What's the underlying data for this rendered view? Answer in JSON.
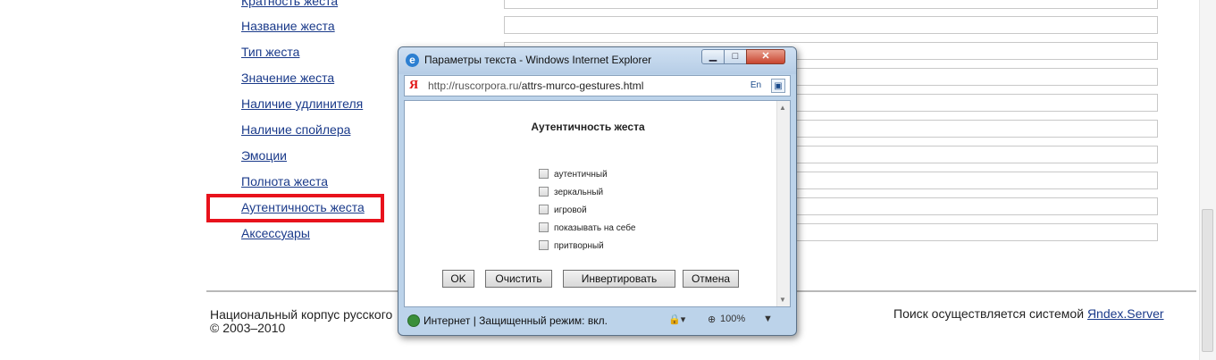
{
  "form": {
    "links": [
      "Кратность жеста",
      "Название жеста",
      "Тип жеста",
      "Значение жеста",
      "Наличие удлинителя",
      "Наличие спойлера",
      "Эмоции",
      "Полнота жеста",
      "Аутентичность жеста",
      "Аксессуары"
    ]
  },
  "footer": {
    "left_line1": "Национальный корпус русского",
    "left_line2": "© 2003–2010",
    "right_text": "Поиск осуществляется системой ",
    "right_link": "Яndex.Server"
  },
  "popup": {
    "title": "Параметры текста - Windows Internet Explorer",
    "url_host": "http://ruscorpora.ru/",
    "url_path": "attrs-murco-gestures.html",
    "dialog_title": "Аутентичность жеста",
    "options": [
      "аутентичный",
      "зеркальный",
      "игровой",
      "показывать на себе",
      "притворный"
    ],
    "buttons": {
      "ok": "OK",
      "clear": "Очистить",
      "invert": "Инвертировать",
      "cancel": "Отмена"
    },
    "status": {
      "zone": "Интернет | Защищенный режим: вкл.",
      "zoom": "100%"
    }
  },
  "icons": {
    "browser": "ie-icon",
    "search_engine": "yandex-icon",
    "status_zone": "globe-icon",
    "zoom": "zoom-icon"
  },
  "colors": {
    "highlight": "#e8121c",
    "link": "#1a3a8a"
  }
}
